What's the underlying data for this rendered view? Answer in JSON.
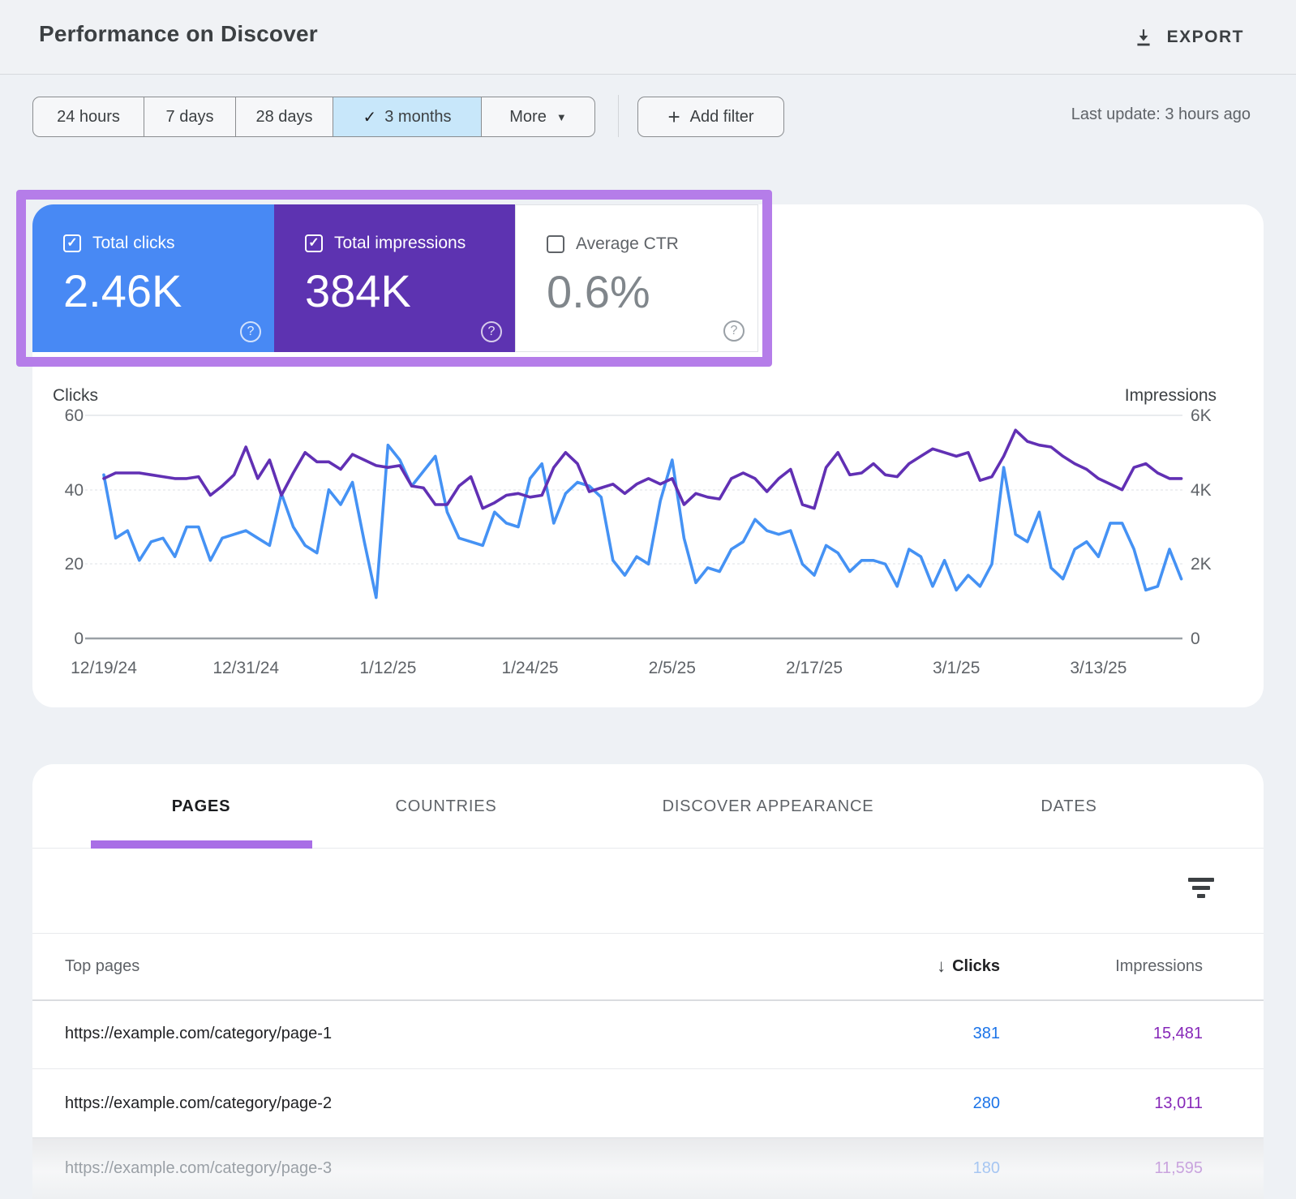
{
  "header": {
    "title": "Performance on Discover",
    "export_label": "EXPORT"
  },
  "filters": {
    "ranges": [
      {
        "label": "24 hours",
        "selected": false
      },
      {
        "label": "7 days",
        "selected": false
      },
      {
        "label": "28 days",
        "selected": false
      },
      {
        "label": "3 months",
        "selected": true
      },
      {
        "label": "More",
        "selected": false,
        "has_menu": true
      }
    ],
    "add_filter_label": "Add filter",
    "last_update": "Last update: 3 hours ago"
  },
  "metric_cards": [
    {
      "label": "Total clicks",
      "value": "2.46K",
      "checked": true,
      "bg": "#4889f4"
    },
    {
      "label": "Total impressions",
      "value": "384K",
      "checked": true,
      "bg": "#5d33b1"
    },
    {
      "label": "Average CTR",
      "value": "0.6%",
      "checked": false,
      "bg": "#ffffff"
    }
  ],
  "annotation": {
    "highlight_color": "#b57de9"
  },
  "chart_data": {
    "type": "line",
    "title": "Performance on Discover - clicks and impressions over 3 months",
    "x_labels": [
      "12/19/24",
      "12/31/24",
      "1/12/25",
      "1/24/25",
      "2/5/25",
      "2/17/25",
      "3/1/25",
      "3/13/25"
    ],
    "x_label_interval_days": 12,
    "grid": true,
    "left_axis": {
      "title": "Clicks",
      "ticks": [
        "60",
        "40",
        "20",
        "0"
      ],
      "max": 60
    },
    "right_axis": {
      "title": "Impressions",
      "ticks": [
        "6K",
        "4K",
        "2K",
        "0"
      ],
      "max": 6000
    },
    "series": [
      {
        "name": "Clicks",
        "axis": "left",
        "color": "#4592f4",
        "values": [
          44,
          27,
          29,
          21,
          26,
          27,
          22,
          30,
          30,
          21,
          27,
          28,
          29,
          27,
          25,
          39,
          30,
          25,
          23,
          40,
          36,
          42,
          26,
          11,
          52,
          48,
          41,
          45,
          49,
          34,
          27,
          26,
          25,
          34,
          31,
          30,
          43,
          47,
          31,
          39,
          42,
          41,
          38,
          21,
          17,
          22,
          20,
          37,
          48,
          27,
          15,
          19,
          18,
          24,
          26,
          32,
          29,
          28,
          29,
          20,
          17,
          25,
          23,
          18,
          21,
          21,
          20,
          14,
          24,
          22,
          14,
          21,
          13,
          17,
          14,
          20,
          46,
          28,
          26,
          34,
          19,
          16,
          24,
          26,
          22,
          31,
          31,
          24,
          13,
          14,
          24,
          16
        ]
      },
      {
        "name": "Impressions",
        "axis": "right",
        "color": "#6130b4",
        "values": [
          4300,
          4450,
          4450,
          4450,
          4400,
          4350,
          4300,
          4300,
          4350,
          3850,
          4100,
          4400,
          5150,
          4300,
          4800,
          3850,
          4450,
          5000,
          4750,
          4750,
          4550,
          4950,
          4800,
          4650,
          4600,
          4650,
          4100,
          4050,
          3600,
          3600,
          4100,
          4350,
          3500,
          3650,
          3850,
          3900,
          3800,
          3850,
          4600,
          5000,
          4700,
          3950,
          4050,
          4150,
          3900,
          4150,
          4300,
          4150,
          4300,
          3600,
          3900,
          3800,
          3750,
          4300,
          4450,
          4300,
          3950,
          4300,
          4550,
          3600,
          3500,
          4600,
          5000,
          4400,
          4450,
          4700,
          4400,
          4350,
          4700,
          4900,
          5100,
          5000,
          4900,
          5000,
          4250,
          4350,
          4900,
          5600,
          5300,
          5200,
          5150,
          4900,
          4700,
          4550,
          4300,
          4150,
          4000,
          4600,
          4700,
          4450,
          4300,
          4300
        ]
      }
    ]
  },
  "table": {
    "tabs": [
      "PAGES",
      "COUNTRIES",
      "DISCOVER APPEARANCE",
      "DATES"
    ],
    "active_tab": "PAGES",
    "underline_color": "#a96ee6",
    "columns": {
      "top_pages": "Top pages",
      "clicks": "Clicks",
      "impressions": "Impressions"
    },
    "sort_column": "Clicks",
    "clicks_value_color": "#1a73e8",
    "impressions_value_color": "#8627b8",
    "rows": [
      {
        "url": "https://example.com/category/page-1",
        "clicks": "381",
        "impressions": "15,481"
      },
      {
        "url": "https://example.com/category/page-2",
        "clicks": "280",
        "impressions": "13,011"
      },
      {
        "url": "https://example.com/category/page-3",
        "clicks": "180",
        "impressions": "11,595",
        "faded": true
      }
    ]
  }
}
